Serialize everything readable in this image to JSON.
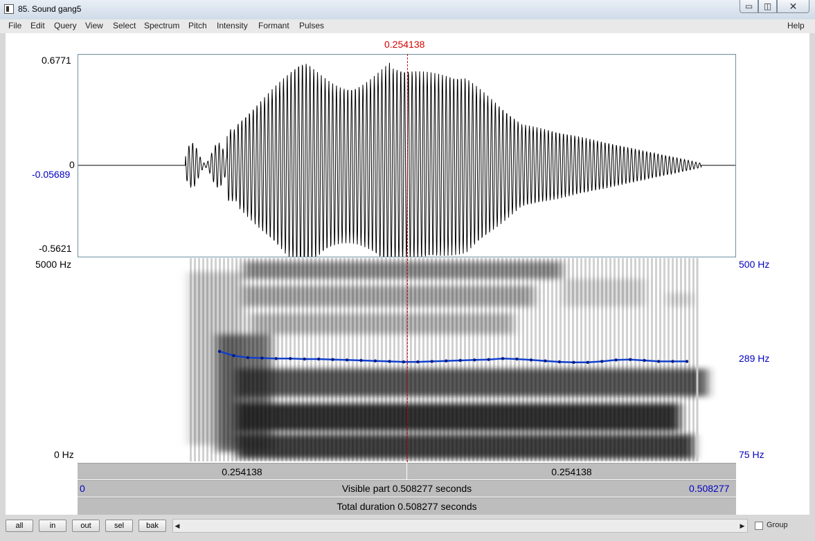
{
  "window": {
    "title": "85. Sound gang5",
    "min_glyph": "▭",
    "max_glyph": "◫",
    "close_glyph": "✕"
  },
  "menu": [
    "File",
    "Edit",
    "Query",
    "View",
    "Select",
    "Spectrum",
    "Pitch",
    "Intensity",
    "Formant",
    "Pulses"
  ],
  "menu_help": "Help",
  "cursor_time": "0.254138",
  "waveform": {
    "ymax": "0.6771",
    "zero": "0",
    "cursor_value": "-0.05689",
    "ymin": "-0.5621"
  },
  "spectrogram": {
    "ymax": "5000 Hz",
    "ymin": "0 Hz"
  },
  "pitch_axis": {
    "top": "500 Hz",
    "mid": "289 Hz",
    "bottom": "75 Hz"
  },
  "pitch_values_hz": [
    305,
    296,
    292,
    291,
    290,
    290,
    289,
    289,
    288,
    287,
    286,
    285,
    284,
    283,
    283,
    284,
    285,
    286,
    287,
    288,
    290,
    289,
    287,
    285,
    283,
    282,
    282,
    284,
    287,
    288,
    286,
    284,
    284,
    284
  ],
  "timebar": {
    "left_segment": "0.254138",
    "right_segment": "0.254138",
    "visible_start": "0",
    "visible_part": "Visible part 0.508277 seconds",
    "visible_end": "0.508277",
    "total": "Total duration 0.508277 seconds"
  },
  "toolbar": {
    "all": "all",
    "in": "in",
    "out": "out",
    "sel": "sel",
    "bak": "bak"
  },
  "scroll": {
    "left_arrow": "◀",
    "right_arrow": "▶"
  },
  "group_label": "Group",
  "colors": {
    "cursor": "#d40000",
    "axis_blue": "#0000c0",
    "pitch": "#1040d0"
  }
}
